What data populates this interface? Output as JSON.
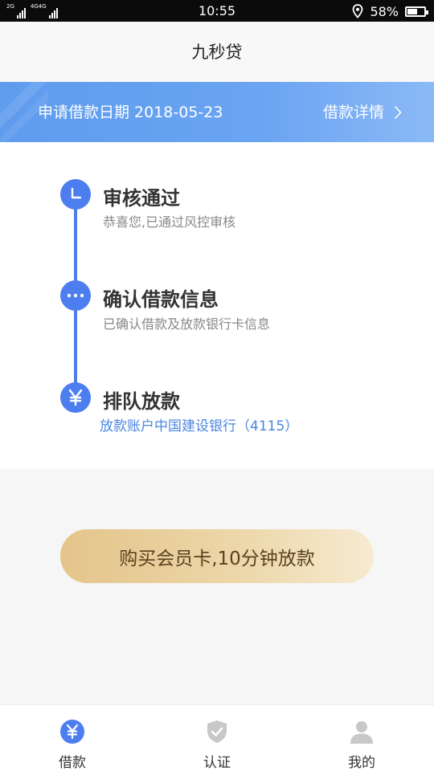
{
  "status_bar": {
    "network": "2G 4G 4G",
    "time": "10:55",
    "battery_percent": "58%",
    "battery_level": 0.58
  },
  "header": {
    "title": "九秒贷"
  },
  "banner": {
    "apply_date": "申请借款日期 2018-05-23",
    "details_label": "借款详情"
  },
  "steps": [
    {
      "title": "审核通过",
      "subtitle": "恭喜您,已通过风控审核",
      "icon": "clock-icon"
    },
    {
      "title": "确认借款信息",
      "subtitle": "已确认借款及放款银行卡信息",
      "icon": "more-dots-icon"
    },
    {
      "title": "排队放款",
      "subtitle": "放款账户中国建设银行（4115）",
      "icon": "yen-icon"
    }
  ],
  "cta": {
    "label": "购买会员卡,10分钟放款"
  },
  "tabbar": {
    "items": [
      {
        "label": "借款",
        "icon": "yen-coin-icon",
        "active": true
      },
      {
        "label": "认证",
        "icon": "shield-check-icon",
        "active": false
      },
      {
        "label": "我的",
        "icon": "person-icon",
        "active": false
      }
    ]
  },
  "colors": {
    "accent": "#4d7ef0",
    "banner": "#6aa4f2",
    "gold": "#e4c48a",
    "link_blue": "#4a86e0",
    "inactive_icon": "#c8c8c8"
  }
}
